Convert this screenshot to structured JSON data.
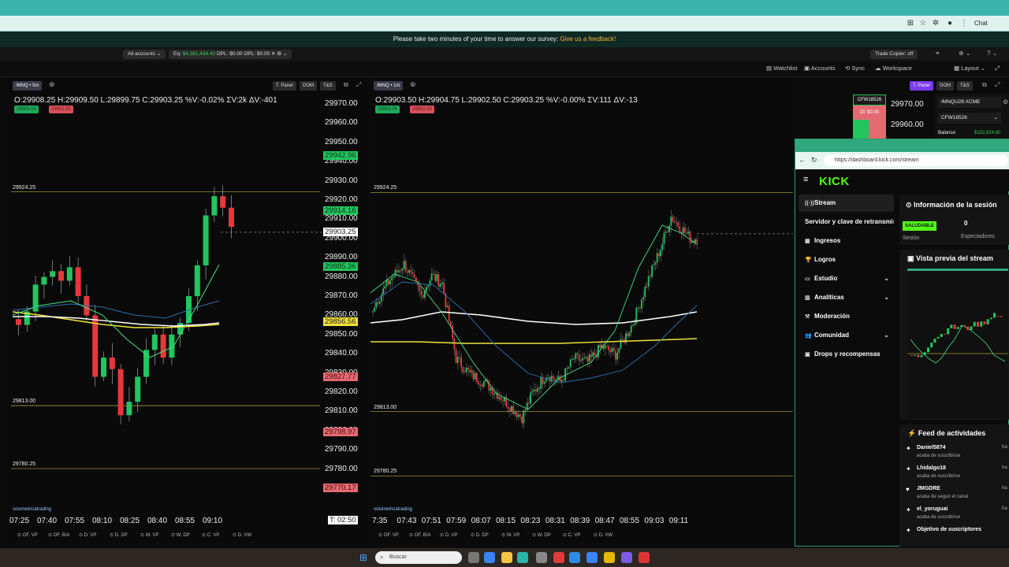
{
  "browser": {
    "chat_label": "Chat"
  },
  "survey": {
    "text": "Please take two minutes of your time to answer our survey:",
    "link": "Give us a feedback!"
  },
  "appbar": {
    "accounts_selector": "All accounts",
    "eq_label": "Eq:",
    "eq_value": "$4,361,434.40",
    "dpl_label": "DPL:",
    "dpl_value": "$0.00",
    "opl_label": "OPL:",
    "opl_value": "$0.00",
    "trade_copier": "Trade Copier: off"
  },
  "toolbar": {
    "watchlist": "Watchlist",
    "accounts": "Accounts",
    "sync": "Sync",
    "workspace": "Workspace",
    "layout": "Layout"
  },
  "chart_left": {
    "symbol": "/MNQ",
    "interval": "5m",
    "buttons": [
      "T. Panel",
      "DOM",
      "T&S"
    ],
    "ohlc": "O:29908.25  H:29909.50  L:29899.75  C:29903.25  %V:-0.02%  ΣV:2k  ΔV:-401",
    "bid_tag": "29903.00",
    "ask_tag": "29902.50",
    "hline_labels": [
      "29924.25",
      "29813.00",
      "29780.25"
    ],
    "price_ticks": [
      "29970.00",
      "29960.00",
      "29950.00",
      "29940.00",
      "29930.00",
      "29920.00",
      "29910.00",
      "29900.00",
      "29890.00",
      "29880.00",
      "29870.00",
      "29860.00",
      "29850.00",
      "29840.00",
      "29830.00",
      "29820.00",
      "29810.00",
      "29800.00",
      "29790.00",
      "29780.00",
      "29770.00"
    ],
    "badges": [
      {
        "text": "29942.96",
        "style": "green"
      },
      {
        "text": "29914.16",
        "style": "green"
      },
      {
        "text": "29903.25",
        "style": "white"
      },
      {
        "text": "29885.36",
        "style": "green"
      },
      {
        "text": "29856.56",
        "style": "yellow"
      },
      {
        "text": "29827.77",
        "style": "red"
      },
      {
        "text": "29798.97",
        "style": "red"
      },
      {
        "text": "29770.17",
        "style": "red"
      }
    ],
    "time_labels": [
      "07:25",
      "07:40",
      "07:55",
      "08:10",
      "08:25",
      "08:40",
      "08:55",
      "09:10"
    ],
    "timer": "T: 02:50",
    "logo": "volumetricatrading",
    "footer": [
      "OF. VP",
      "OF. B/A",
      "D. VP",
      "D. DP",
      "W. VP",
      "W. DP",
      "C. VP",
      "D. VW"
    ]
  },
  "chart_right": {
    "symbol": "/MNQ",
    "interval": "1m",
    "buttons": [
      "T. Panel",
      "DOM",
      "T&S"
    ],
    "ohlc": "O:29903.50  H:29904.75  L:29902.50  C:29903.25  %V:-0.00%  ΣV:111  ΔV:-13",
    "bid_tag": "29903.00",
    "ask_tag": "29902.50",
    "hline_labels": [
      "29924.25",
      "29813.00",
      "29780.25"
    ],
    "price_ticks": [
      "29970.00",
      "29960.00"
    ],
    "time_labels": [
      "7:35",
      "07:43",
      "07:51",
      "07:59",
      "08:07",
      "08:15",
      "08:23",
      "08:31",
      "08:39",
      "08:47",
      "08:55",
      "09:03",
      "09:11"
    ],
    "logo": "volumetricatrading",
    "footer": [
      "OF. VP",
      "OF. B/A",
      "D. VP",
      "D. DP",
      "W. VP",
      "W. DP",
      "C. VP",
      "D. VW"
    ],
    "account_chip": "CFW18526",
    "dl_chip": "Dl: $0.00"
  },
  "account_panel": {
    "symbol_select": "/MNQU28:XCME",
    "account_select": "CFW18526",
    "balance_label": "Balance:",
    "balance_value": "$152,824.60"
  },
  "kick": {
    "url": "https://dashboard.kick.com/stream",
    "logo": "KICK",
    "nav": [
      {
        "label": "Stream",
        "icon": "stream-icon",
        "glyph": "((·))",
        "active": true,
        "chevron": false
      },
      {
        "label": "Servidor y clave de retransmisión",
        "icon": "",
        "glyph": "",
        "active": false,
        "chevron": false
      },
      {
        "label": "Ingresos",
        "icon": "revenue-icon",
        "glyph": "▦",
        "active": false,
        "chevron": false
      },
      {
        "label": "Logros",
        "icon": "trophy-icon",
        "glyph": "🏆",
        "active": false,
        "chevron": false
      },
      {
        "label": "Estudio",
        "icon": "studio-icon",
        "glyph": "▭",
        "active": false,
        "chevron": true
      },
      {
        "label": "Analíticas",
        "icon": "analytics-icon",
        "glyph": "▥",
        "active": false,
        "chevron": true
      },
      {
        "label": "Moderación",
        "icon": "hammer-icon",
        "glyph": "⚒",
        "active": false,
        "chevron": false
      },
      {
        "label": "Comunidad",
        "icon": "community-icon",
        "glyph": "👥",
        "active": false,
        "chevron": true
      },
      {
        "label": "Drops y recompensas",
        "icon": "gift-icon",
        "glyph": "▣",
        "active": false,
        "chevron": false
      }
    ],
    "session_card": {
      "title": "Información de la sesión",
      "status_badge": "SALUDABLE",
      "session_label": "Sesión",
      "viewers_value": "0",
      "viewers_label": "Espectadores"
    },
    "preview_title": "Vista previa del stream",
    "feed": {
      "title": "Feed de actividades",
      "items": [
        {
          "name": "Daniel5874",
          "action": "acaba de suscribirse",
          "when": "ha"
        },
        {
          "name": "Lhidalgo18",
          "action": "acaba de suscribirse",
          "when": "ha"
        },
        {
          "name": "JMGDRE",
          "action": "acaba de seguir el canal",
          "when": "ha"
        },
        {
          "name": "el_yoruguai",
          "action": "acaba de suscribirse",
          "when": "ha"
        },
        {
          "name": "Objetivo de suscriptores",
          "action": "",
          "when": ""
        }
      ]
    }
  },
  "taskbar": {
    "search_placeholder": "Buscar"
  },
  "colors": {
    "candle_up": "#22c55e",
    "candle_down": "#e5383b",
    "ema_fast": "#4ade80",
    "ema_slow": "#2f6fb0",
    "vwap": "#f1e33a",
    "sma_white": "#ffffff",
    "kick_green": "#53fc18"
  }
}
